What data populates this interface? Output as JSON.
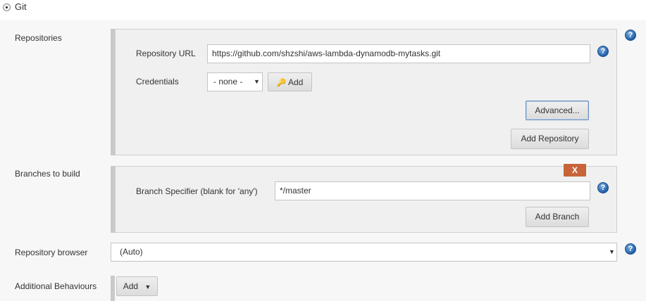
{
  "scm": {
    "option_label": "Git"
  },
  "repositories": {
    "section_label": "Repositories",
    "url_label": "Repository URL",
    "url_value": "https://github.com/shzshi/aws-lambda-dynamodb-mytasks.git",
    "credentials_label": "Credentials",
    "credentials_selected": "- none -",
    "add_credentials_label": "Add",
    "advanced_label": "Advanced...",
    "add_repository_label": "Add Repository"
  },
  "branches": {
    "section_label": "Branches to build",
    "delete_label": "X",
    "specifier_label": "Branch Specifier (blank for 'any')",
    "specifier_value": "*/master",
    "add_branch_label": "Add Branch"
  },
  "repository_browser": {
    "label": "Repository browser",
    "selected": "(Auto)"
  },
  "additional_behaviours": {
    "label": "Additional Behaviours",
    "add_label": "Add"
  },
  "help_icon_glyph": "?",
  "colors": {
    "delete_button": "#c8643a",
    "help_icon": "#1f5fa8",
    "focus_border": "#6c8ebf"
  }
}
